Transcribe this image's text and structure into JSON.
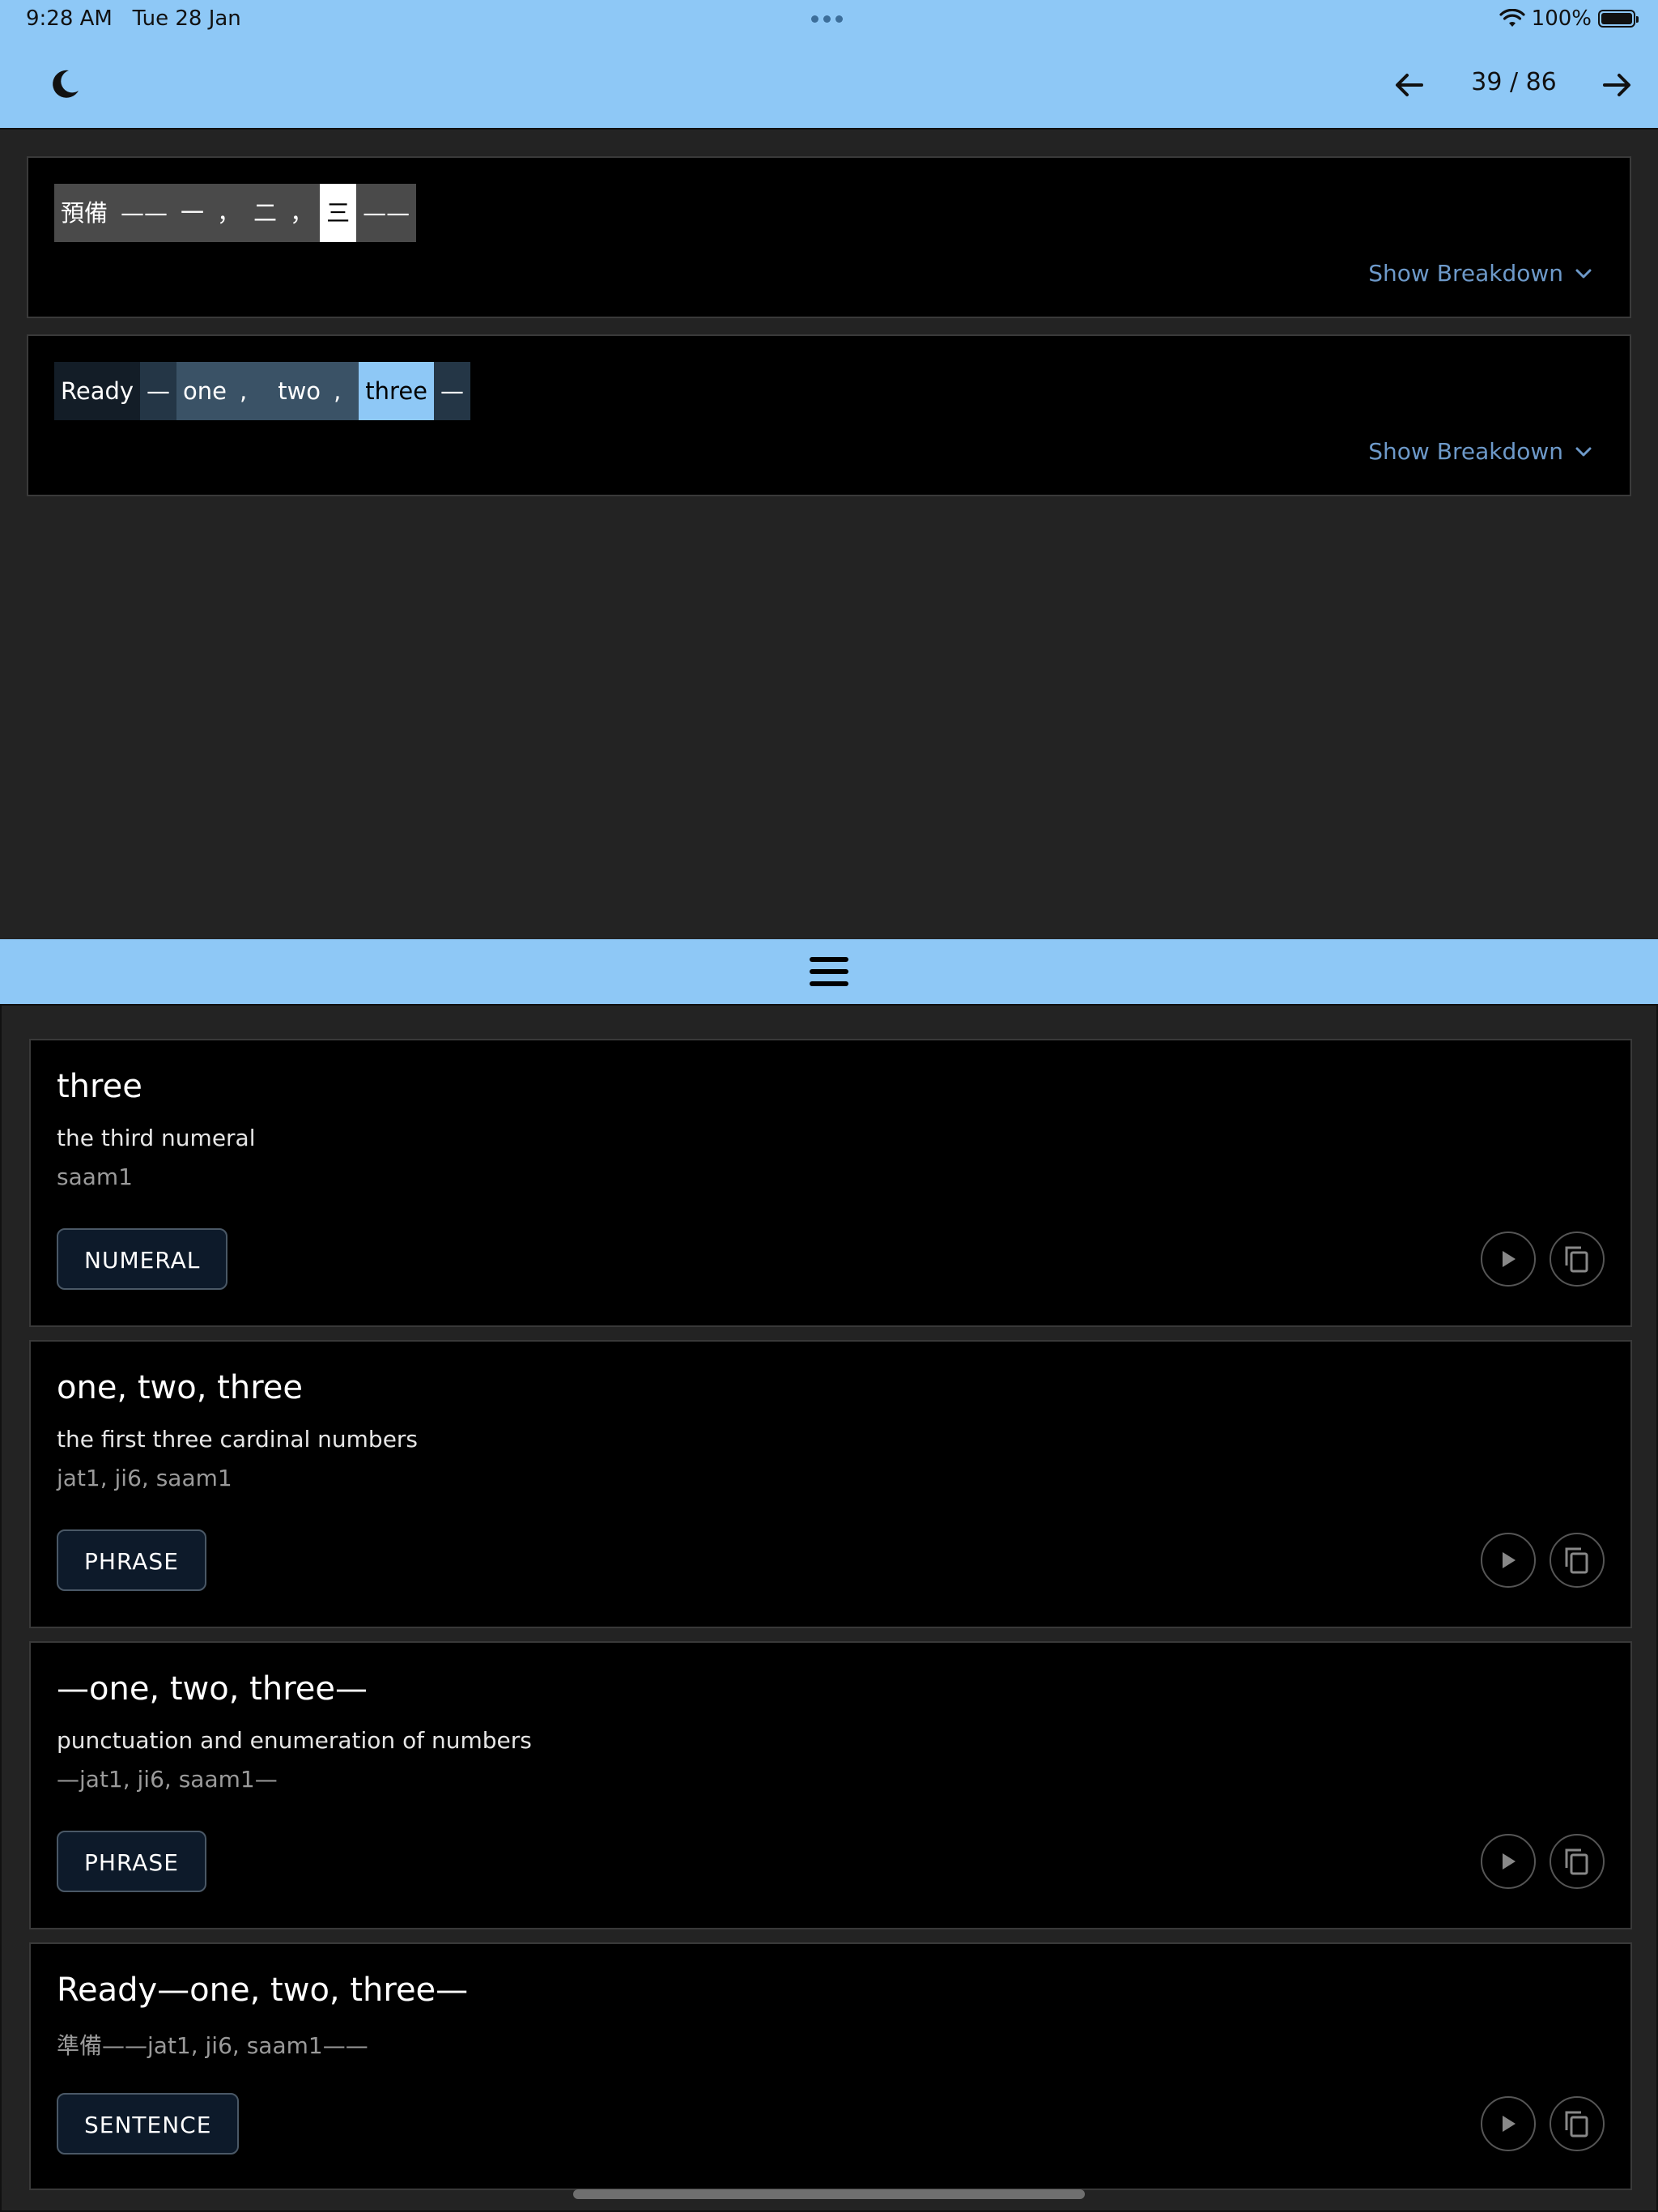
{
  "status": {
    "time": "9:28 AM",
    "date": "Tue 28 Jan",
    "battery": "100%"
  },
  "header": {
    "page_counter": "39 / 86"
  },
  "colors": {
    "accent": "#8ec8f6",
    "background": "#232323",
    "card": "#000000",
    "link": "#6d99c9"
  },
  "sentences": [
    {
      "show_breakdown": "Show Breakdown",
      "tokens": [
        "預備",
        "——",
        "一",
        "，",
        "二",
        "，",
        "三",
        "——"
      ]
    },
    {
      "show_breakdown": "Show Breakdown",
      "tokens": [
        "Ready",
        "—",
        "one",
        ",",
        "two",
        ",",
        "three",
        "—"
      ]
    }
  ],
  "entries": [
    {
      "title": "three",
      "definition": "the third numeral",
      "romanization": "saam1",
      "tag": "NUMERAL"
    },
    {
      "title": "one, two, three",
      "definition": "the first three cardinal numbers",
      "romanization": "jat1, ji6, saam1",
      "tag": "PHRASE"
    },
    {
      "title": "—one, two, three—",
      "definition": "punctuation and enumeration of numbers",
      "romanization": "—jat1, ji6, saam1—",
      "tag": "PHRASE"
    },
    {
      "title": "Ready—one, two, three—",
      "definition": "",
      "romanization": "準備——jat1, ji6, saam1——",
      "tag": "SENTENCE"
    }
  ]
}
